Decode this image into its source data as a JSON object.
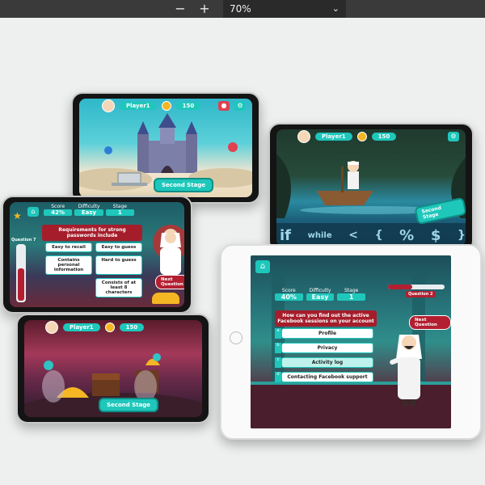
{
  "toolbar": {
    "zoom_out_icon": "minus",
    "zoom_in_icon": "plus",
    "zoom_value": "70%",
    "dropdown_icon": "chevron-down"
  },
  "phone_castle": {
    "player_name": "Player1",
    "coins": "150",
    "stage_button": "Second Stage"
  },
  "phone_boat": {
    "player_name": "Player1",
    "coins": "150",
    "stage_button": "Second Stage",
    "code_words": [
      "if",
      "while",
      "<",
      "{",
      "%",
      "$",
      "}"
    ]
  },
  "phone_quiz": {
    "stats": [
      {
        "head": "Score",
        "value": "42%"
      },
      {
        "head": "Difficulty",
        "value": "Easy"
      },
      {
        "head": "Stage",
        "value": "1"
      }
    ],
    "question": "Requirements for strong passwords include",
    "question_label": "Question 7",
    "options": [
      "Easy to recall",
      "Easy to guess",
      "Contains personal information",
      "Hard to guess",
      "Consists of at least 8 characters"
    ],
    "next_button": "Next Question"
  },
  "phone_treasure": {
    "player_name": "Player1",
    "coins": "150",
    "stage_button": "Second Stage"
  },
  "tablet_quiz": {
    "stats": [
      {
        "head": "Score",
        "value": "40%"
      },
      {
        "head": "Difficulty",
        "value": "Easy"
      },
      {
        "head": "Stage",
        "value": "1"
      }
    ],
    "question_label": "Question 2",
    "question": "How can you find out the active Facebook sessions on your account",
    "options": [
      {
        "letter": "a",
        "text": "Profile"
      },
      {
        "letter": "b",
        "text": "Privacy"
      },
      {
        "letter": "c",
        "text": "Activity log"
      },
      {
        "letter": "d",
        "text": "Contacting Facebook support"
      }
    ],
    "next_button": "Next Question"
  },
  "colors": {
    "accent": "#1fc7bb",
    "quiz_red": "#a51d2b",
    "coin": "#f4b623"
  }
}
